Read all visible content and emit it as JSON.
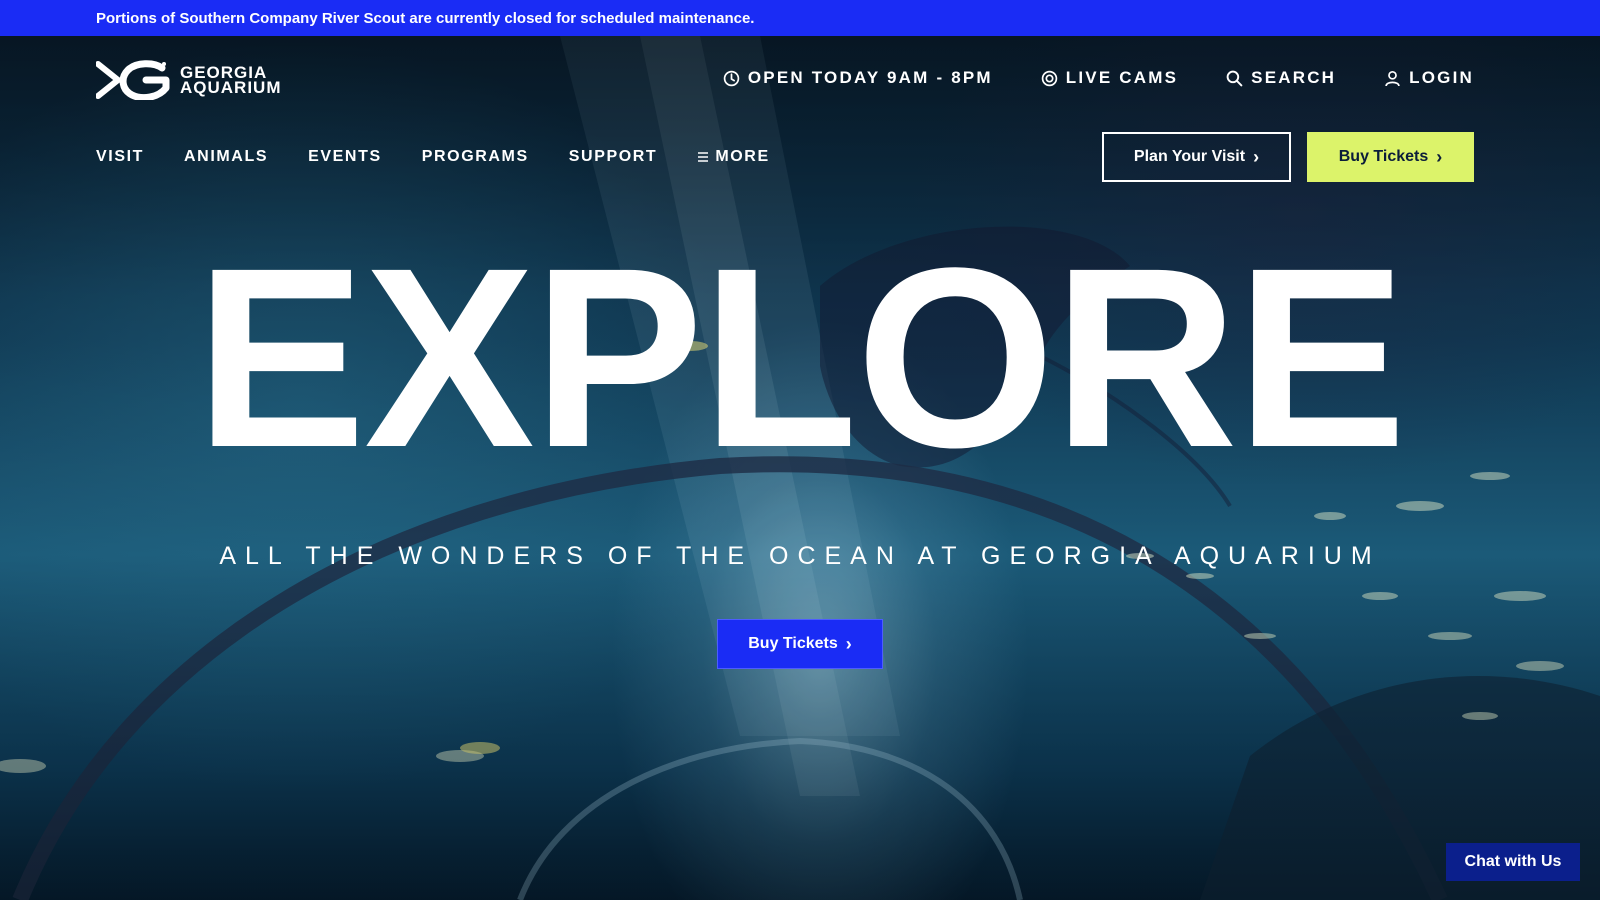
{
  "alert": {
    "text": "Portions of Southern Company River Scout are currently closed for scheduled maintenance."
  },
  "logo": {
    "line1": "GEORGIA",
    "line2": "AQUARIUM",
    "icon": "fish-g-logo"
  },
  "utility_nav": [
    {
      "icon": "clock-icon",
      "label": "OPEN TODAY 9AM - 8PM"
    },
    {
      "icon": "camera-icon",
      "label": "LIVE CAMS"
    },
    {
      "icon": "search-icon",
      "label": "SEARCH"
    },
    {
      "icon": "user-icon",
      "label": "LOGIN"
    }
  ],
  "main_nav": [
    {
      "label": "VISIT"
    },
    {
      "label": "ANIMALS"
    },
    {
      "label": "EVENTS"
    },
    {
      "label": "PROGRAMS"
    },
    {
      "label": "SUPPORT"
    },
    {
      "label": "MORE",
      "icon": "hamburger-icon"
    }
  ],
  "header_buttons": {
    "plan_visit": "Plan Your Visit",
    "buy_tickets": "Buy Tickets"
  },
  "hero": {
    "headline": "EXPLORE",
    "tagline": "ALL THE WONDERS OF THE OCEAN AT GEORGIA AQUARIUM",
    "cta": "Buy Tickets"
  },
  "chat": {
    "label": "Chat with Us"
  },
  "colors": {
    "alert_bg": "#1a2cf5",
    "accent_lime": "#dcf36a",
    "cta_blue": "#1a2cf5",
    "chat_bg": "#0b1f8c"
  }
}
